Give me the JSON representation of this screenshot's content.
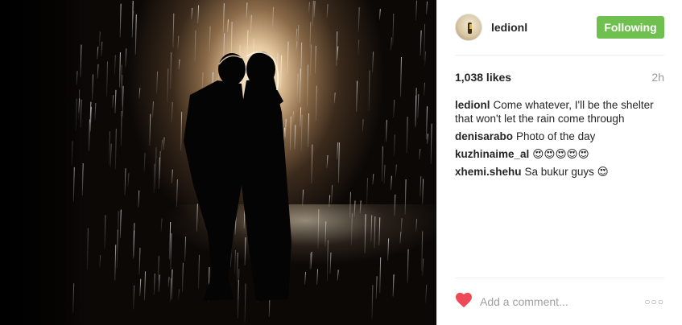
{
  "post": {
    "photo_alt": "",
    "header": {
      "username": "ledionl",
      "follow_label": "Following"
    },
    "stats": {
      "likes": "1,038 likes",
      "time": "2h"
    },
    "comments": [
      {
        "user": "ledionl",
        "text": "Come whatever, I'll be the shelter that won't let the rain come through"
      },
      {
        "user": "denisarabo",
        "text": "Photo of the day"
      },
      {
        "user": "kuzhinaime_al",
        "text": "😍😍😍😍😍"
      },
      {
        "user": "xhemi.shehu",
        "text": "Sa bukur guys 😍"
      }
    ],
    "footer": {
      "comment_placeholder": "Add a comment...",
      "more_label": "○○○"
    },
    "colors": {
      "follow_button": "#70c050",
      "heart": "#ed4956"
    },
    "icons": {
      "like": "heart-icon",
      "more": "more-options-icon"
    }
  }
}
